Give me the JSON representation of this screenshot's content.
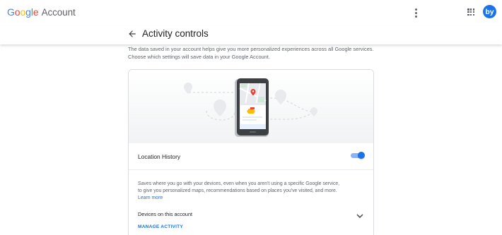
{
  "app": {
    "logo_google": "Google",
    "logo_account": "Account",
    "avatar_initials": "by",
    "google_colors": [
      "#4285F4",
      "#EA4335",
      "#FBBC05",
      "#4285F4",
      "#34A853",
      "#EA4335"
    ]
  },
  "header": {
    "title": "Activity controls"
  },
  "intro": {
    "text": "The data saved in your account helps give you more personalized experiences across all Google services. Choose which settings will save data in your Google Account."
  },
  "location_history": {
    "label": "Location History",
    "enabled": true,
    "description": "Saves where you go with your devices, even when you aren't using a specific Google service, to give you personalized maps, recommendations based on places you've visited, and more.",
    "learn_more": "Learn more",
    "devices_label": "Devices on this account",
    "manage_label": "MANAGE ACTIVITY"
  },
  "icons": {
    "menu": "more-vert-icon",
    "apps": "apps-grid-icon",
    "back": "arrow-back-icon",
    "expand": "chevron-down-icon"
  },
  "colors": {
    "accent": "#1a73e8",
    "toggle_track": "#8ab4f8",
    "text_primary": "#202124",
    "text_secondary": "#5f6368",
    "border": "#dadce0"
  }
}
